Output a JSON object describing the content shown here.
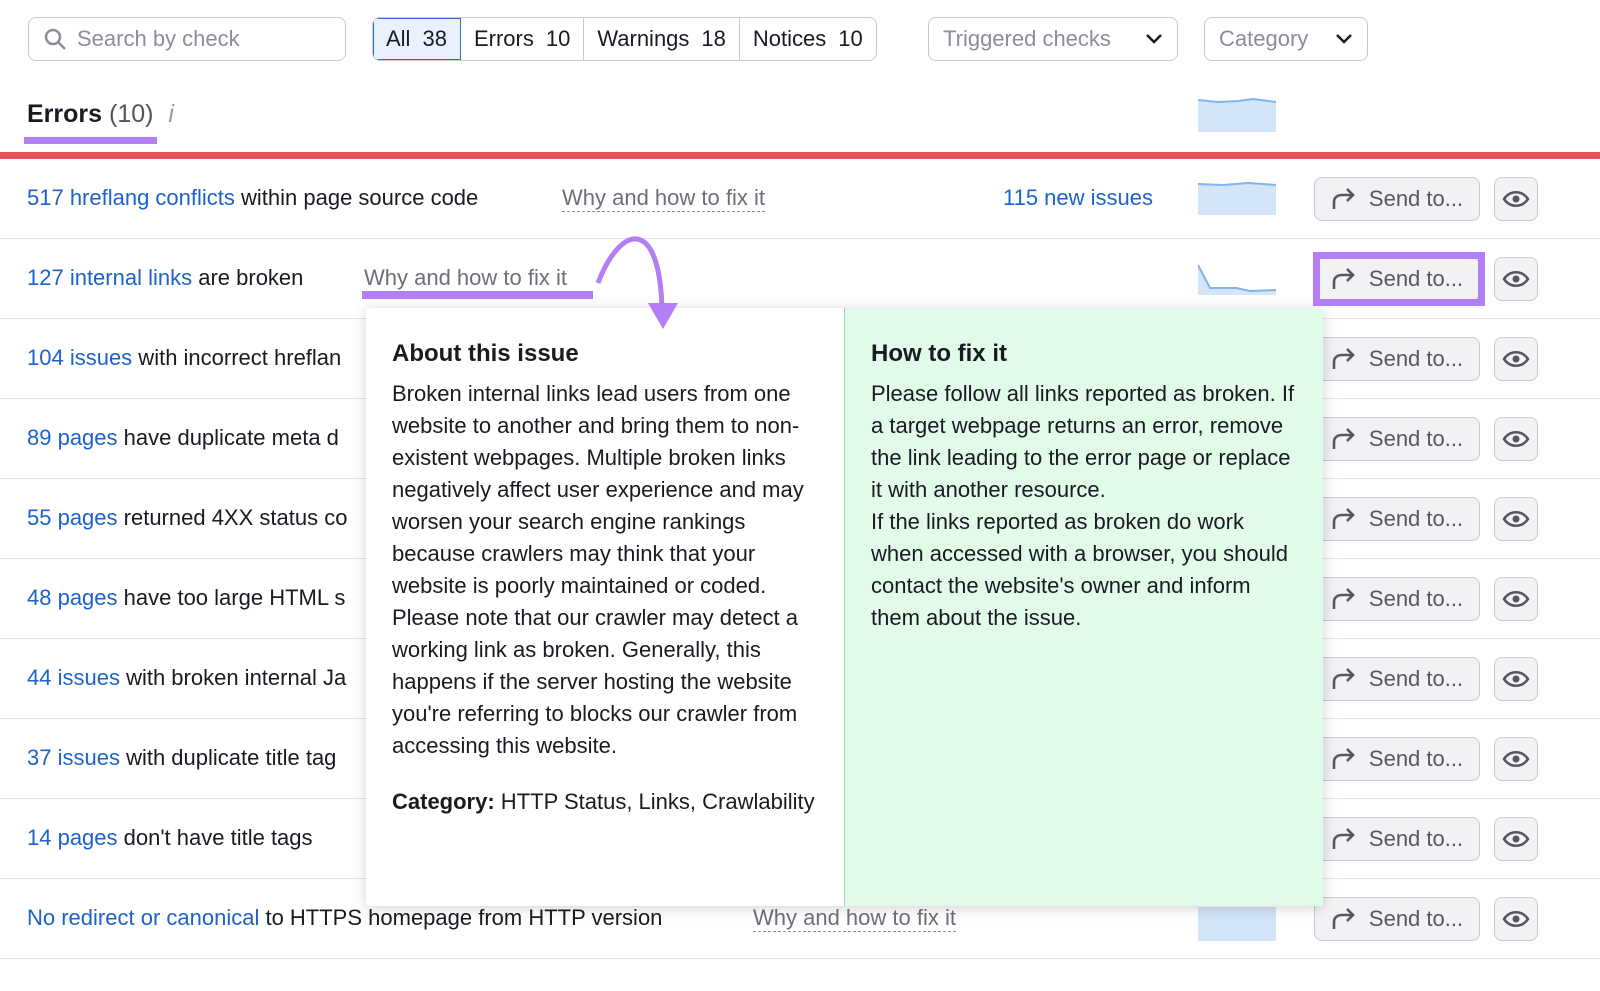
{
  "search": {
    "placeholder": "Search by check",
    "icon": "search-icon"
  },
  "filters": [
    {
      "label": "All",
      "count": "38",
      "active": true
    },
    {
      "label": "Errors",
      "count": "10"
    },
    {
      "label": "Warnings",
      "count": "18"
    },
    {
      "label": "Notices",
      "count": "10"
    }
  ],
  "dropdowns": {
    "triggered": "Triggered checks",
    "category": "Category"
  },
  "section": {
    "title": "Errors",
    "count": "(10)",
    "info": "i"
  },
  "colors": {
    "accent": "#b47ff5",
    "error": "#e8545a",
    "link": "#1b63cc",
    "fix_bg": "#e1fbe8"
  },
  "rows": [
    {
      "link": "517 hreflang conflicts",
      "rest": " within page source code",
      "why": "Why and how to fix it",
      "new_issues": "115 new issues",
      "send": "Send to..."
    },
    {
      "link": "127 internal links",
      "rest": " are broken",
      "why": "Why and how to fix it",
      "send": "Send to..."
    },
    {
      "link": "104 issues",
      "rest": " with incorrect hreflan",
      "send": "Send to..."
    },
    {
      "link": "89 pages",
      "rest": " have duplicate meta d",
      "send": "Send to..."
    },
    {
      "link": "55 pages",
      "rest": " returned 4XX status co",
      "send": "Send to..."
    },
    {
      "link": "48 pages",
      "rest": " have too large HTML s",
      "send": "Send to..."
    },
    {
      "link": "44 issues",
      "rest": " with broken internal Ja",
      "send": "Send to..."
    },
    {
      "link": "37 issues",
      "rest": " with duplicate title tag",
      "send": "Send to..."
    },
    {
      "link": "14 pages",
      "rest": " don't have title tags",
      "send": "Send to..."
    },
    {
      "link": "No redirect or canonical",
      "rest": " to HTTPS homepage from HTTP version",
      "why": "Why and how to fix it",
      "send": "Send to..."
    }
  ],
  "popup": {
    "about_title": "About this issue",
    "about_p1": "Broken internal links lead users from one website to another and bring them to non-existent webpages. Multiple broken links negatively affect user experience and may worsen your search engine rankings because crawlers may think that your website is poorly maintained or coded.",
    "about_p2": "Please note that our crawler may detect a working link as broken. Generally, this happens if the server hosting the website you're referring to blocks our crawler from accessing this website.",
    "category_label": "Category:",
    "category_value": " HTTP Status, Links, Crawlability",
    "fix_title": "How to fix it",
    "fix_p1": "Please follow all links reported as broken. If a target webpage returns an error, remove the link leading to the error page or replace it with another resource.",
    "fix_p2": "If the links reported as broken do work when accessed with a browser, you should contact the website's owner and inform them about the issue."
  }
}
